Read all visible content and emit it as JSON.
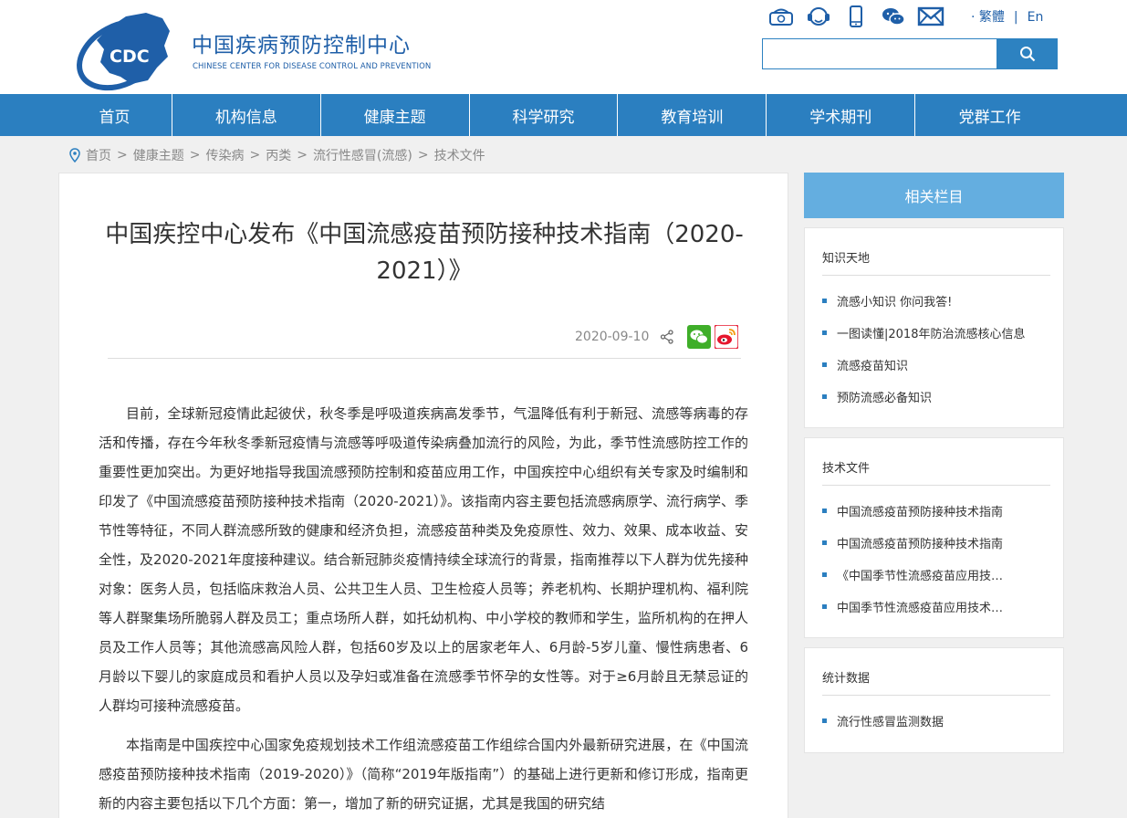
{
  "header": {
    "logo_text": "CDC",
    "org_name_cn": "中国疾病预防控制中心",
    "org_name_en": "CHINESE CENTER FOR DISEASE CONTROL AND PREVENTION",
    "icons": [
      "phone-icon",
      "customer-service-icon",
      "mobile-icon",
      "wechat-icon",
      "mail-icon"
    ],
    "lang_traditional": "· 繁體",
    "lang_sep": "|",
    "lang_english": "En",
    "search_placeholder": ""
  },
  "nav": {
    "items": [
      "首页",
      "机构信息",
      "健康主题",
      "科学研究",
      "教育培训",
      "学术期刊",
      "党群工作"
    ]
  },
  "breadcrumb": {
    "items": [
      "首页",
      "健康主题",
      "传染病",
      "丙类",
      "流行性感冒(流感)",
      "技术文件"
    ],
    "separator": ">"
  },
  "article": {
    "title": "中国疾控中心发布《中国流感疫苗预防接种技术指南（2020-2021）》",
    "date": "2020-09-10",
    "paragraphs": [
      "目前，全球新冠疫情此起彼伏，秋冬季是呼吸道疾病高发季节，气温降低有利于新冠、流感等病毒的存活和传播，存在今年秋冬季新冠疫情与流感等呼吸道传染病叠加流行的风险，为此，季节性流感防控工作的重要性更加突出。为更好地指导我国流感预防控制和疫苗应用工作，中国疾控中心组织有关专家及时编制和印发了《中国流感疫苗预防接种技术指南（2020-2021）》。该指南内容主要包括流感病原学、流行病学、季节性等特征，不同人群流感所致的健康和经济负担，流感疫苗种类及免疫原性、效力、效果、成本收益、安全性，及2020-2021年度接种建议。结合新冠肺炎疫情持续全球流行的背景，指南推荐以下人群为优先接种对象：医务人员，包括临床救治人员、公共卫生人员、卫生检疫人员等；养老机构、长期护理机构、福利院等人群聚集场所脆弱人群及员工；重点场所人群，如托幼机构、中小学校的教师和学生，监所机构的在押人员及工作人员等；其他流感高风险人群，包括60岁及以上的居家老年人、6月龄-5岁儿童、慢性病患者、6月龄以下婴儿的家庭成员和看护人员以及孕妇或准备在流感季节怀孕的女性等。对于≥6月龄且无禁忌证的人群均可接种流感疫苗。",
      "本指南是中国疾控中心国家免疫规划技术工作组流感疫苗工作组综合国内外最新研究进展，在《中国流感疫苗预防接种技术指南（2019-2020）》（简称“2019年版指南”）的基础上进行更新和修订形成，指南更新的内容主要包括以下几个方面：第一，增加了新的研究证据，尤其是我国的研究结"
    ]
  },
  "sidebar": {
    "header": "相关栏目",
    "sections": [
      {
        "title": "知识天地",
        "items": [
          "流感小知识 你问我答!",
          "一图读懂|2018年防治流感核心信息",
          "流感疫苗知识",
          "预防流感必备知识"
        ]
      },
      {
        "title": "技术文件",
        "items": [
          "中国流感疫苗预防接种技术指南",
          "中国流感疫苗预防接种技术指南",
          "《中国季节性流感疫苗应用技术指南》",
          "中国季节性流感疫苗应用技术指南"
        ]
      },
      {
        "title": "统计数据",
        "items": [
          "流行性感冒监测数据"
        ]
      }
    ]
  },
  "colors": {
    "brand_blue": "#1f5fa8",
    "nav_blue": "#2b7fc0",
    "sidebar_head": "#64aee0",
    "page_bg": "#f0f0f0"
  }
}
